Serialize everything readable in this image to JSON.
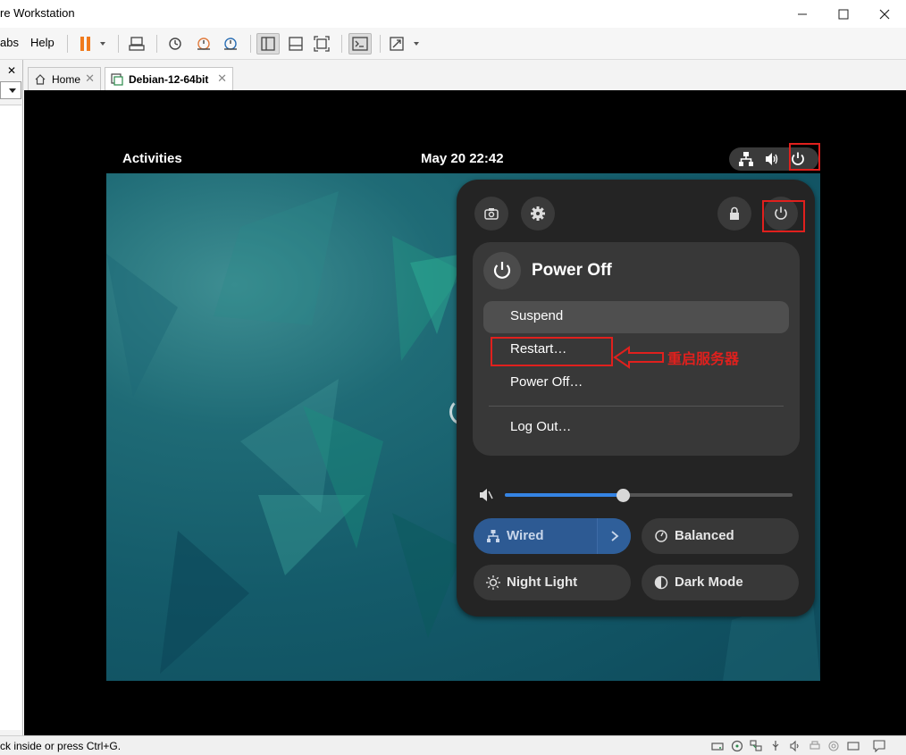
{
  "window": {
    "title": "re Workstation",
    "min": "—",
    "max": "☐",
    "close": "✕"
  },
  "menu": {
    "tabs_item": "abs",
    "help_item": "Help"
  },
  "tabs": [
    {
      "label": "Home",
      "close": "✕"
    },
    {
      "label": "Debian-12-64bit",
      "close": "✕"
    }
  ],
  "gnome": {
    "activities": "Activities",
    "clock": "May 20  22:42"
  },
  "quick_settings": {
    "power_menu": {
      "title": "Power Off",
      "items": [
        "Suspend",
        "Restart…",
        "Power Off…",
        "Log Out…"
      ]
    },
    "volume_level": 0.41,
    "toggles": [
      {
        "label": "Wired",
        "active": true
      },
      {
        "label": "Balanced",
        "active": false
      },
      {
        "label": "Night Light",
        "active": false
      },
      {
        "label": "Dark Mode",
        "active": false
      }
    ]
  },
  "annotation": {
    "text": "重启服务器",
    "color": "#e0201d"
  },
  "statusbar": {
    "text": "ck inside or press Ctrl+G."
  },
  "colors": {
    "accent": "#3584e4",
    "highlight": "#e0201d"
  }
}
